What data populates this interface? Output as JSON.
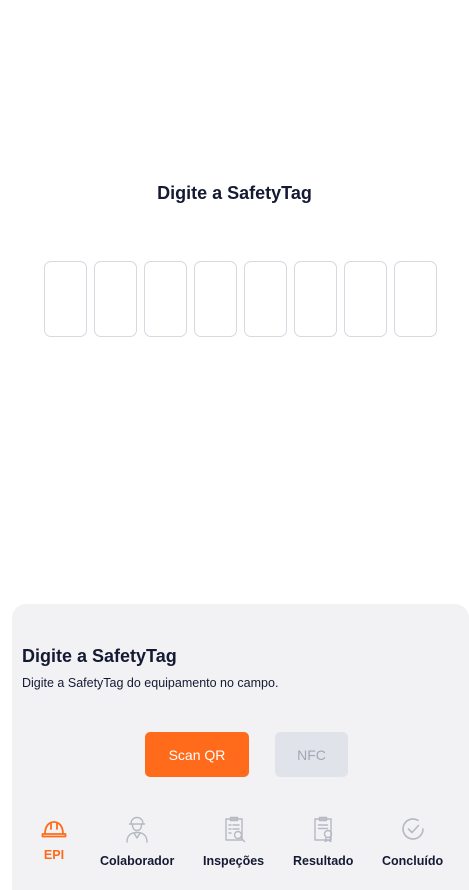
{
  "main": {
    "title": "Digite a SafetyTag",
    "tag_slots": 8
  },
  "sheet": {
    "title": "Digite a SafetyTag",
    "subtitle": "Digite a SafetyTag do equipamento no campo.",
    "scan_qr_label": "Scan QR",
    "nfc_label": "NFC"
  },
  "nav": {
    "items": [
      {
        "label": "EPI",
        "icon": "hard-hat-icon",
        "active": true
      },
      {
        "label": "Colaborador",
        "icon": "worker-icon",
        "active": false
      },
      {
        "label": "Inspeções",
        "icon": "inspection-clipboard-icon",
        "active": false
      },
      {
        "label": "Resultado",
        "icon": "result-document-icon",
        "active": false
      },
      {
        "label": "Concluído",
        "icon": "check-circle-icon",
        "active": false
      }
    ]
  },
  "colors": {
    "accent": "#ff6b1a",
    "text": "#141a33",
    "disabled": "#a3a7b4",
    "sheet_bg": "#f2f2f4"
  }
}
